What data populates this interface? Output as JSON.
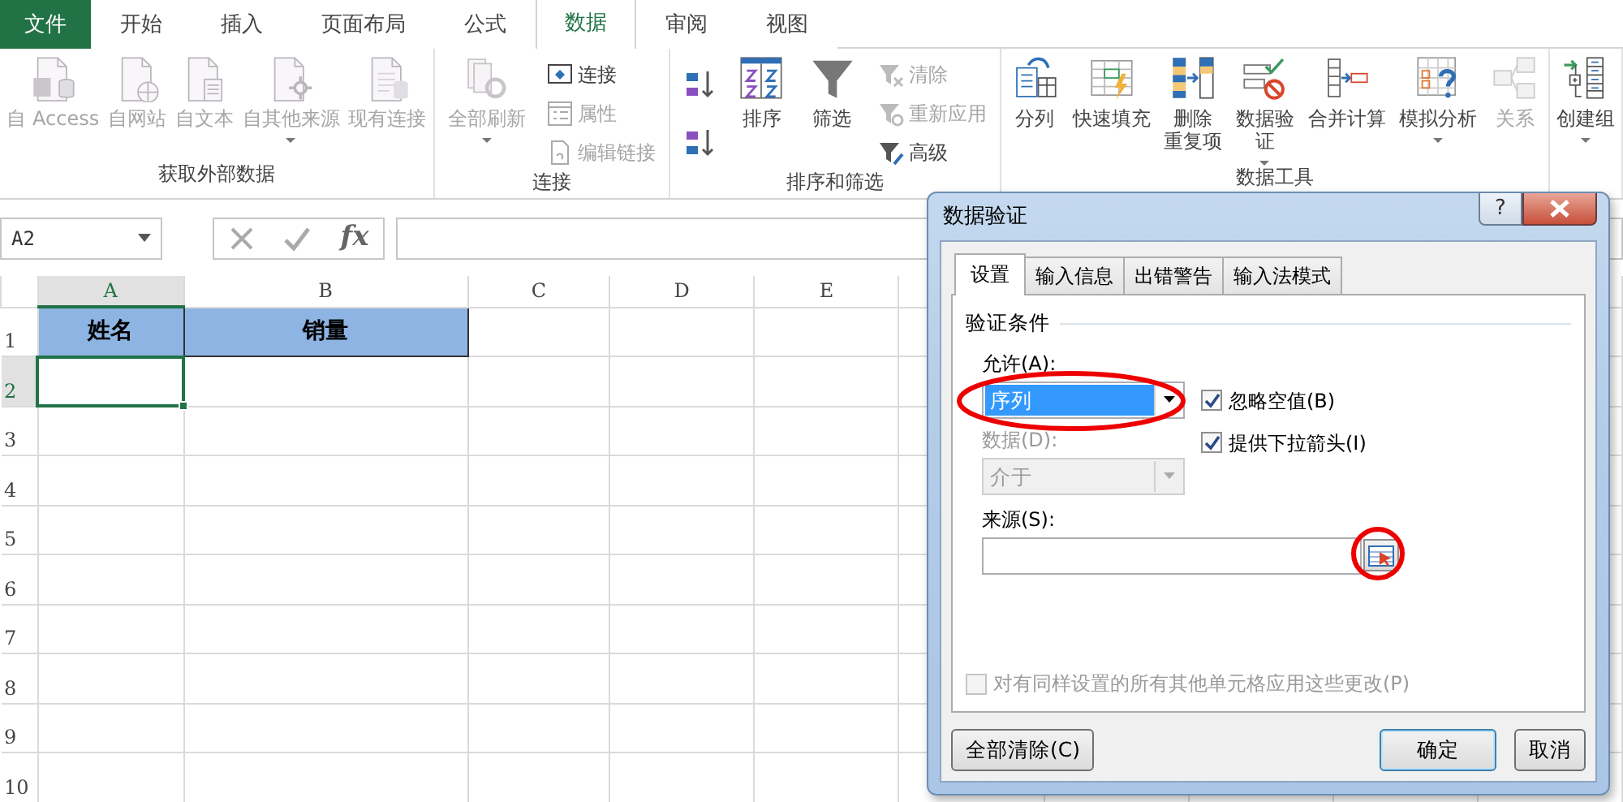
{
  "ribbon_tabs": [
    {
      "label": "文件",
      "kind": "file",
      "selected": false
    },
    {
      "label": "开始",
      "kind": "tab",
      "selected": false
    },
    {
      "label": "插入",
      "kind": "tab",
      "selected": false
    },
    {
      "label": "页面布局",
      "kind": "tab",
      "selected": false
    },
    {
      "label": "公式",
      "kind": "tab",
      "selected": false
    },
    {
      "label": "数据",
      "kind": "tab",
      "selected": true
    },
    {
      "label": "审阅",
      "kind": "tab",
      "selected": false
    },
    {
      "label": "视图",
      "kind": "tab",
      "selected": false
    }
  ],
  "ribbon_groups": [
    {
      "label": "获取外部数据",
      "items": [
        {
          "kind": "large",
          "lines": [
            "自 Access"
          ],
          "disabled": true,
          "dropdown": false
        },
        {
          "kind": "large",
          "lines": [
            "自网站"
          ],
          "disabled": true,
          "dropdown": false
        },
        {
          "kind": "large",
          "lines": [
            "自文本"
          ],
          "disabled": true,
          "dropdown": false
        },
        {
          "kind": "large",
          "lines": [
            "自其他来源"
          ],
          "disabled": true,
          "dropdown": true
        },
        {
          "kind": "large",
          "lines": [
            "现有连接"
          ],
          "disabled": true,
          "dropdown": false
        }
      ]
    },
    {
      "label": "连接",
      "items": [
        {
          "kind": "large",
          "lines": [
            "全部刷新"
          ],
          "disabled": true,
          "dropdown": true
        },
        {
          "kind": "stack",
          "items": [
            {
              "label": "连接",
              "disabled": false
            },
            {
              "label": "属性",
              "disabled": true
            },
            {
              "label": "编辑链接",
              "disabled": true
            }
          ]
        }
      ]
    },
    {
      "label": "排序和筛选",
      "items": [
        {
          "kind": "sort-pair"
        },
        {
          "kind": "large",
          "lines": [
            "排序"
          ],
          "disabled": false,
          "dropdown": false
        },
        {
          "kind": "large",
          "lines": [
            "筛选"
          ],
          "disabled": false,
          "dropdown": false
        },
        {
          "kind": "stack",
          "items": [
            {
              "label": "清除",
              "disabled": true
            },
            {
              "label": "重新应用",
              "disabled": true
            },
            {
              "label": "高级",
              "disabled": false
            }
          ]
        }
      ]
    },
    {
      "label": "数据工具",
      "items": [
        {
          "kind": "large",
          "lines": [
            "分列"
          ],
          "disabled": false,
          "dropdown": false
        },
        {
          "kind": "large",
          "lines": [
            "快速填充"
          ],
          "disabled": false,
          "dropdown": false
        },
        {
          "kind": "large",
          "lines": [
            "删除",
            "重复项"
          ],
          "disabled": false,
          "dropdown": false
        },
        {
          "kind": "large",
          "lines": [
            "数据验",
            "证"
          ],
          "disabled": false,
          "dropdown": true
        },
        {
          "kind": "large",
          "lines": [
            "合并计算"
          ],
          "disabled": false,
          "dropdown": false
        },
        {
          "kind": "large",
          "lines": [
            "模拟分析"
          ],
          "disabled": false,
          "dropdown": true
        },
        {
          "kind": "large",
          "lines": [
            "关系"
          ],
          "disabled": true,
          "dropdown": false
        }
      ]
    },
    {
      "items": [
        {
          "kind": "large",
          "lines": [
            "创建组"
          ],
          "disabled": false,
          "dropdown": true
        }
      ]
    }
  ],
  "formula_bar": {
    "name_box": "A2",
    "insert_function": "fx"
  },
  "sheet": {
    "columns": [
      {
        "label": "A",
        "selected": true
      },
      {
        "label": "B",
        "selected": false
      },
      {
        "label": "C",
        "selected": false
      },
      {
        "label": "D",
        "selected": false
      },
      {
        "label": "E",
        "selected": false
      }
    ],
    "rows": [
      {
        "label": "1",
        "selected": false,
        "cells": [
          "姓名",
          "销量"
        ]
      },
      {
        "label": "2",
        "selected": true
      },
      {
        "label": "3",
        "selected": false
      },
      {
        "label": "4",
        "selected": false
      },
      {
        "label": "5",
        "selected": false
      },
      {
        "label": "6",
        "selected": false
      },
      {
        "label": "7",
        "selected": false
      },
      {
        "label": "8",
        "selected": false
      },
      {
        "label": "9",
        "selected": false
      },
      {
        "label": "10",
        "selected": false
      }
    ]
  },
  "dialog": {
    "title": "数据验证",
    "help_button": "?",
    "tabs": [
      {
        "label": "设置",
        "selected": true
      },
      {
        "label": "输入信息",
        "selected": false
      },
      {
        "label": "出错警告",
        "selected": false
      },
      {
        "label": "输入法模式",
        "selected": false
      }
    ],
    "section": "验证条件",
    "allow": {
      "label": "允许(A):",
      "value": "序列"
    },
    "checkboxes": [
      {
        "label": "忽略空值(B)",
        "checked": true
      },
      {
        "label": "提供下拉箭头(I)",
        "checked": true
      }
    ],
    "data": {
      "label": "数据(D):",
      "value": "介于",
      "disabled": true
    },
    "source": {
      "label": "来源(S):"
    },
    "apply_all": {
      "label": "对有同样设置的所有其他单元格应用这些更改(P)",
      "checked": false,
      "disabled": true
    },
    "buttons": [
      {
        "label": "全部清除(C)",
        "kind": "plain"
      },
      {
        "label": "确定",
        "kind": "default"
      },
      {
        "label": "取消",
        "kind": "plain"
      }
    ]
  }
}
